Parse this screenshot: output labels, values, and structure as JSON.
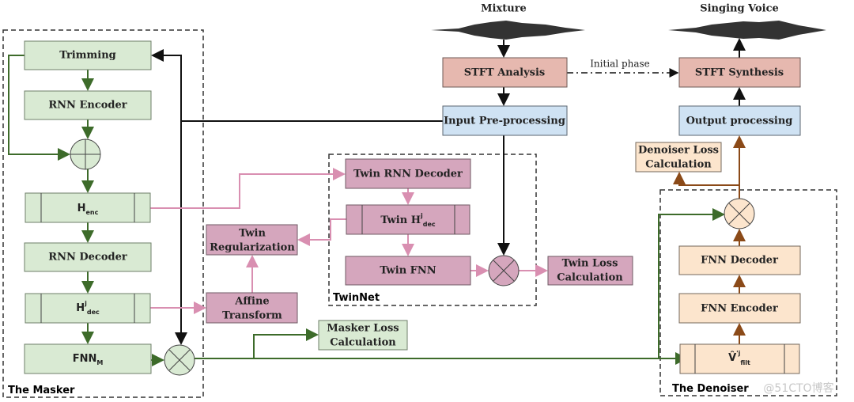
{
  "masker": {
    "label": "The Masker",
    "trimming": "Trimming",
    "rnn_encoder": "RNN Encoder",
    "h_enc": {
      "main": "H",
      "sub": "enc"
    },
    "rnn_decoder": "RNN Decoder",
    "h_dec": {
      "main": "H",
      "sup": "j",
      "sub": "dec"
    },
    "fnn_m": {
      "main": "FNN",
      "sub": "M"
    }
  },
  "twinnet": {
    "label": "TwinNet",
    "twin_rnn_decoder": "Twin RNN Decoder",
    "twin_h_dec": {
      "main": "Twin H",
      "sup": "j",
      "sub": "dec"
    },
    "twin_fnn": "Twin  FNN",
    "twin_loss": [
      "Twin  Loss",
      "Calculation"
    ],
    "twin_regularization": [
      "Twin",
      "Regularization"
    ],
    "affine_transform": [
      "Affine",
      "Transform"
    ]
  },
  "masker_loss": [
    "Masker Loss",
    "Calculation"
  ],
  "io": {
    "mixture": "Mixture",
    "singing_voice": "Singing Voice",
    "stft_analysis": "STFT Analysis",
    "stft_synthesis": "STFT Synthesis",
    "input_preprocessing": "Input Pre-processing",
    "output_processing": "Output processing",
    "initial_phase": "Initial phase"
  },
  "denoiser": {
    "label": "The Denoiser",
    "loss": [
      "Denoiser Loss",
      "Calculation"
    ],
    "fnn_decoder": "FNN Decoder",
    "fnn_encoder": "FNN Encoder",
    "v_filt": {
      "main": "V̂",
      "sup": "'j",
      "sub": "filt"
    }
  },
  "watermark": "@51CTO博客",
  "colors": {
    "masker": "#d9ead3",
    "twinnet": "#d5a6bd",
    "stft": "#e6b8af",
    "processing": "#cfe2f3",
    "denoiser": "#fce5cd"
  }
}
